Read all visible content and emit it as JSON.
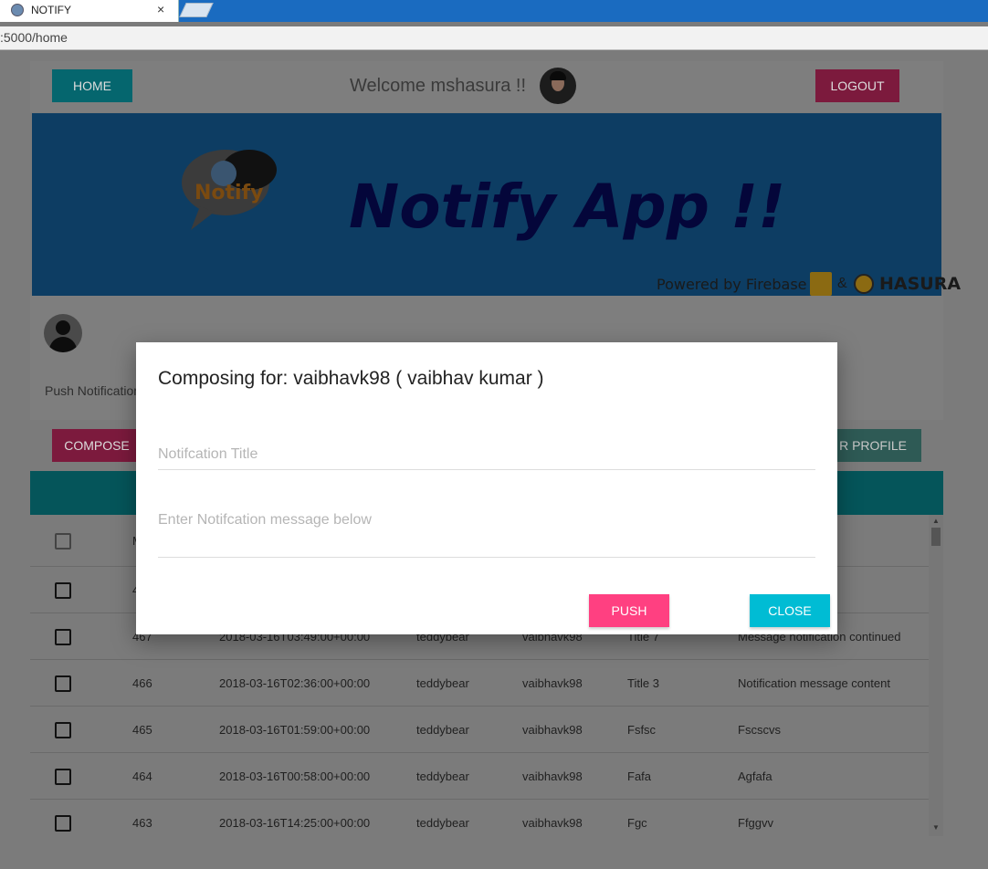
{
  "browser": {
    "tab_title": "NOTIFY",
    "tab_close": "×",
    "url": ":5000/home"
  },
  "topbar": {
    "home_label": "HOME",
    "welcome_text": "Welcome mshasura !!",
    "logout_label": "LOGOUT"
  },
  "banner": {
    "title": "Notify App !!",
    "logo_text": "Notify",
    "powered_by": "Powered by Firebase",
    "amp": "&",
    "hasura": "HASURA"
  },
  "profile": {
    "push_label": "Push Notification"
  },
  "actions": {
    "compose_label": "COMPOSE",
    "profile_label": "R PROFILE"
  },
  "table": {
    "header_partial": "M",
    "rows": [
      {
        "id": "4",
        "time": "",
        "from": "",
        "to": "",
        "title": "",
        "message": ""
      },
      {
        "id": "467",
        "time": "2018-03-16T03:49:00+00:00",
        "from": "teddybear",
        "to": "vaibhavk98",
        "title": "Title 7",
        "message": "Message notification continued"
      },
      {
        "id": "466",
        "time": "2018-03-16T02:36:00+00:00",
        "from": "teddybear",
        "to": "vaibhavk98",
        "title": "Title 3",
        "message": "Notification message content"
      },
      {
        "id": "465",
        "time": "2018-03-16T01:59:00+00:00",
        "from": "teddybear",
        "to": "vaibhavk98",
        "title": "Fsfsc",
        "message": "Fscscvs"
      },
      {
        "id": "464",
        "time": "2018-03-16T00:58:00+00:00",
        "from": "teddybear",
        "to": "vaibhavk98",
        "title": "Fafa",
        "message": "Agfafa"
      },
      {
        "id": "463",
        "time": "2018-03-16T14:25:00+00:00",
        "from": "teddybear",
        "to": "vaibhavk98",
        "title": "Fgc",
        "message": "Ffggvv"
      }
    ]
  },
  "modal": {
    "title": "Composing for: vaibhavk98 ( vaibhav kumar )",
    "title_placeholder": "Notifcation Title",
    "title_value": "",
    "message_placeholder": "Enter Notifcation message below",
    "message_value": "",
    "push_label": "PUSH",
    "close_label": "CLOSE"
  },
  "colors": {
    "primary_teal": "#00bcd4",
    "accent_pink": "#ff4081",
    "banner_blue": "#1f7ec8",
    "overlay": "rgba(0,0,0,0.5)"
  }
}
